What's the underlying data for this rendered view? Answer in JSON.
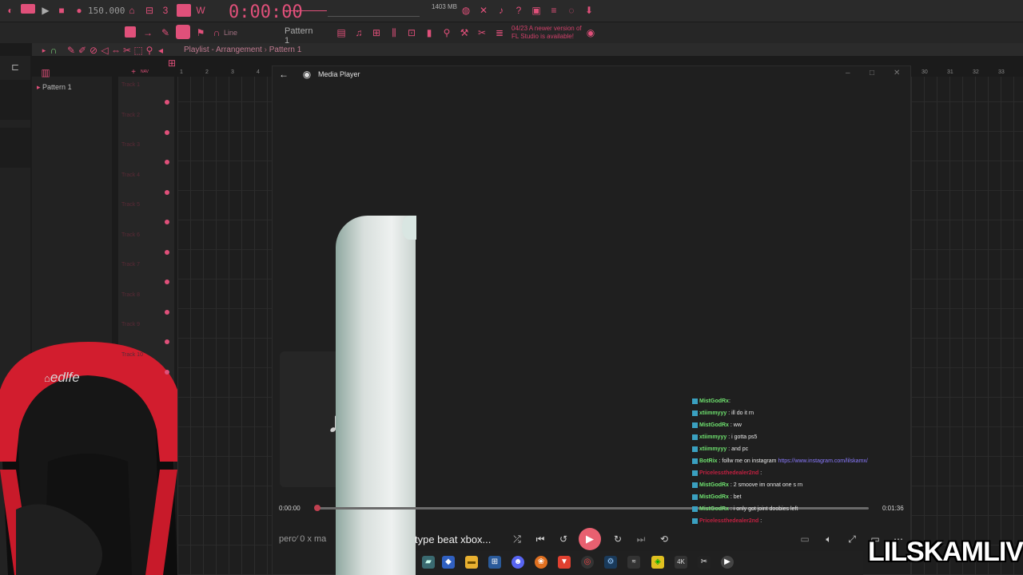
{
  "fl": {
    "tempo": "150.000",
    "time": "0:00:00",
    "memory": "1403 MB",
    "memory_sub": "0",
    "pattern_button": "Pattern 1",
    "snap_label": "Line",
    "news_line1": "04/23  A newer version of",
    "news_line2": "FL Studio is available!",
    "playlist_title": "Playlist - Arrangement",
    "playlist_pattern": "Pattern 1",
    "pattern_item": "Pattern 1",
    "tracks": [
      "Track 1",
      "Track 2",
      "Track 3",
      "Track 4",
      "Track 5",
      "Track 6",
      "Track 7",
      "Track 8",
      "Track 9",
      "Track 10"
    ],
    "ruler_left": [
      "1",
      "2",
      "3",
      "4"
    ],
    "ruler_right": [
      "30",
      "31",
      "32",
      "33"
    ]
  },
  "media_player": {
    "title": "Media Player",
    "time_start": "0:00:00",
    "time_end": "0:01:36",
    "progress": 0.0,
    "song_left": "perc⁄ 0 x ma",
    "song_right": "type beat xbox..."
  },
  "chat": [
    {
      "user": "MistGodRx",
      "msg": ": ",
      "color": "g"
    },
    {
      "user": "xtiimmyyy",
      "msg": " : ill do it rn",
      "color": "g"
    },
    {
      "user": "MistGodRx",
      "msg": " : ww",
      "color": "g"
    },
    {
      "user": "xtiimmyyy",
      "msg": " : i gotta ps5",
      "color": "g"
    },
    {
      "user": "xtiimmyyy",
      "msg": " : and pc",
      "color": "g"
    },
    {
      "user": "BotRix",
      "msg": " : follw me on instagram ",
      "link": "https://www.instagram.com/lilskamx/",
      "color": "g"
    },
    {
      "user": "Pricelessthedealer2nd",
      "msg": " : ",
      "color": "r"
    },
    {
      "user": "MistGodRx",
      "msg": " : 2 smoove im onnat one s rn",
      "color": "g"
    },
    {
      "user": "MistGodRx",
      "msg": " : bet",
      "color": "g"
    },
    {
      "user": "MistGodRx",
      "msg": " : i only got joint doobies left",
      "color": "g"
    },
    {
      "user": "Pricelessthedealer2nd",
      "msg": " : ",
      "color": "r"
    }
  ],
  "chair_brand": "edlfe",
  "watermark": "LILSKAMLIVE"
}
